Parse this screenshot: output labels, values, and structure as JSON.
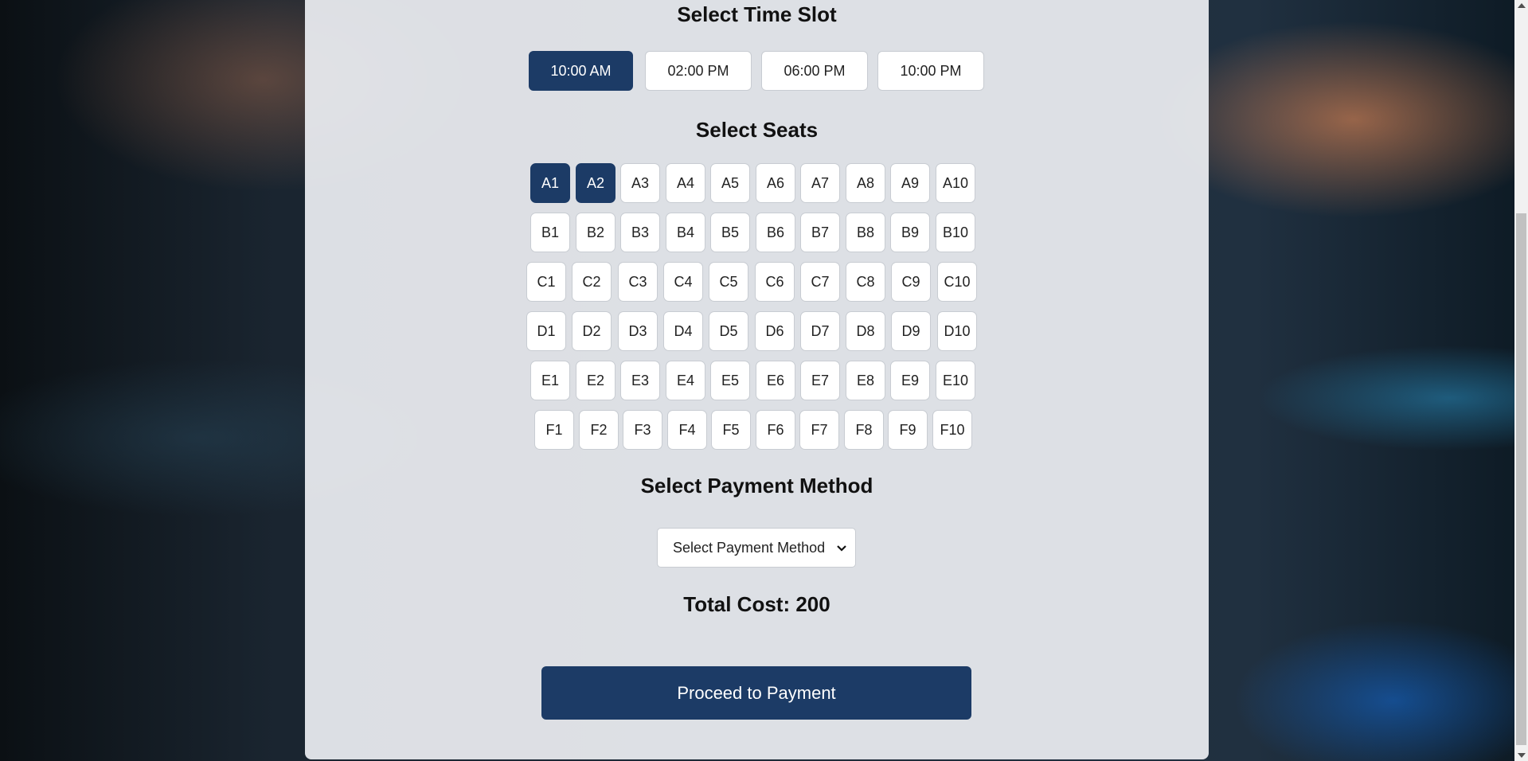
{
  "time_section": {
    "title": "Select Time Slot",
    "slots": [
      {
        "label": "10:00 AM",
        "selected": true
      },
      {
        "label": "02:00 PM",
        "selected": false
      },
      {
        "label": "06:00 PM",
        "selected": false
      },
      {
        "label": "10:00 PM",
        "selected": false
      }
    ]
  },
  "seat_section": {
    "title": "Select Seats",
    "rows": [
      {
        "seats": [
          {
            "label": "A1",
            "selected": true
          },
          {
            "label": "A2",
            "selected": true
          },
          {
            "label": "A3"
          },
          {
            "label": "A4"
          },
          {
            "label": "A5"
          },
          {
            "label": "A6"
          },
          {
            "label": "A7"
          },
          {
            "label": "A8"
          },
          {
            "label": "A9"
          },
          {
            "label": "A10"
          }
        ]
      },
      {
        "seats": [
          {
            "label": "B1"
          },
          {
            "label": "B2"
          },
          {
            "label": "B3"
          },
          {
            "label": "B4"
          },
          {
            "label": "B5"
          },
          {
            "label": "B6"
          },
          {
            "label": "B7"
          },
          {
            "label": "B8"
          },
          {
            "label": "B9"
          },
          {
            "label": "B10"
          }
        ]
      },
      {
        "seats": [
          {
            "label": "C1"
          },
          {
            "label": "C2"
          },
          {
            "label": "C3"
          },
          {
            "label": "C4"
          },
          {
            "label": "C5"
          },
          {
            "label": "C6"
          },
          {
            "label": "C7"
          },
          {
            "label": "C8"
          },
          {
            "label": "C9"
          },
          {
            "label": "C10"
          }
        ]
      },
      {
        "seats": [
          {
            "label": "D1"
          },
          {
            "label": "D2"
          },
          {
            "label": "D3"
          },
          {
            "label": "D4"
          },
          {
            "label": "D5"
          },
          {
            "label": "D6"
          },
          {
            "label": "D7"
          },
          {
            "label": "D8"
          },
          {
            "label": "D9"
          },
          {
            "label": "D10"
          }
        ]
      },
      {
        "seats": [
          {
            "label": "E1"
          },
          {
            "label": "E2"
          },
          {
            "label": "E3"
          },
          {
            "label": "E4"
          },
          {
            "label": "E5"
          },
          {
            "label": "E6"
          },
          {
            "label": "E7"
          },
          {
            "label": "E8"
          },
          {
            "label": "E9"
          },
          {
            "label": "E10"
          }
        ]
      },
      {
        "seats": [
          {
            "label": "F1"
          },
          {
            "label": "F2"
          },
          {
            "label": "F3"
          },
          {
            "label": "F4"
          },
          {
            "label": "F5"
          },
          {
            "label": "F6"
          },
          {
            "label": "F7"
          },
          {
            "label": "F8"
          },
          {
            "label": "F9"
          },
          {
            "label": "F10"
          }
        ]
      }
    ]
  },
  "payment_section": {
    "title": "Select Payment Method",
    "select_value": "Select Payment Method",
    "chevron_icon": "chevron-down-icon"
  },
  "total": "Total Cost: 200",
  "proceed_label": "Proceed to Payment",
  "colors": {
    "accent": "#1c3b66",
    "panel": "#eceef2"
  }
}
